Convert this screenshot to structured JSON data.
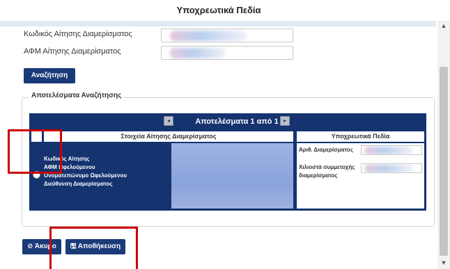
{
  "header": {
    "title": "Υποχρεωτικά Πεδία"
  },
  "search_form": {
    "fields": [
      {
        "label": "Κωδικός Αίτησης Διαμερίσματος",
        "value": ""
      },
      {
        "label": "ΑΦΜ Αίτησης Διαμερίσματος",
        "value": ""
      }
    ],
    "search_label": "Αναζήτηση"
  },
  "results": {
    "legend": "Αποτελέσματα Αναζήτησης",
    "pager_text": "Αποτελέσματα 1 από 1",
    "pager_prev_icon": "◂",
    "pager_next_icon": "▸",
    "col_headers": [
      "Στοιχεία Αίτησης Διαμερίσματος",
      "Υποχρεωτικά Πεδία"
    ],
    "row": {
      "labels": [
        "Κωδικός Αίτησης",
        "ΑΦΜ Ωφελούμενου",
        "Ονοματεπώνυμο Ωφελούμενου",
        "Διεύθυνση Διαμερίσματος"
      ],
      "mandatory": [
        {
          "label": "Αριθ. Διαμερίσματος"
        },
        {
          "label": "Χιλιοστά συμμετοχής διαμερίσματος"
        }
      ]
    }
  },
  "footer": {
    "cancel_label": "⊘ Άκυρο",
    "save_label": "🖫 Αποθήκευση"
  },
  "colors": {
    "primary": "#1a3a78",
    "highlight": "#cc0000"
  }
}
